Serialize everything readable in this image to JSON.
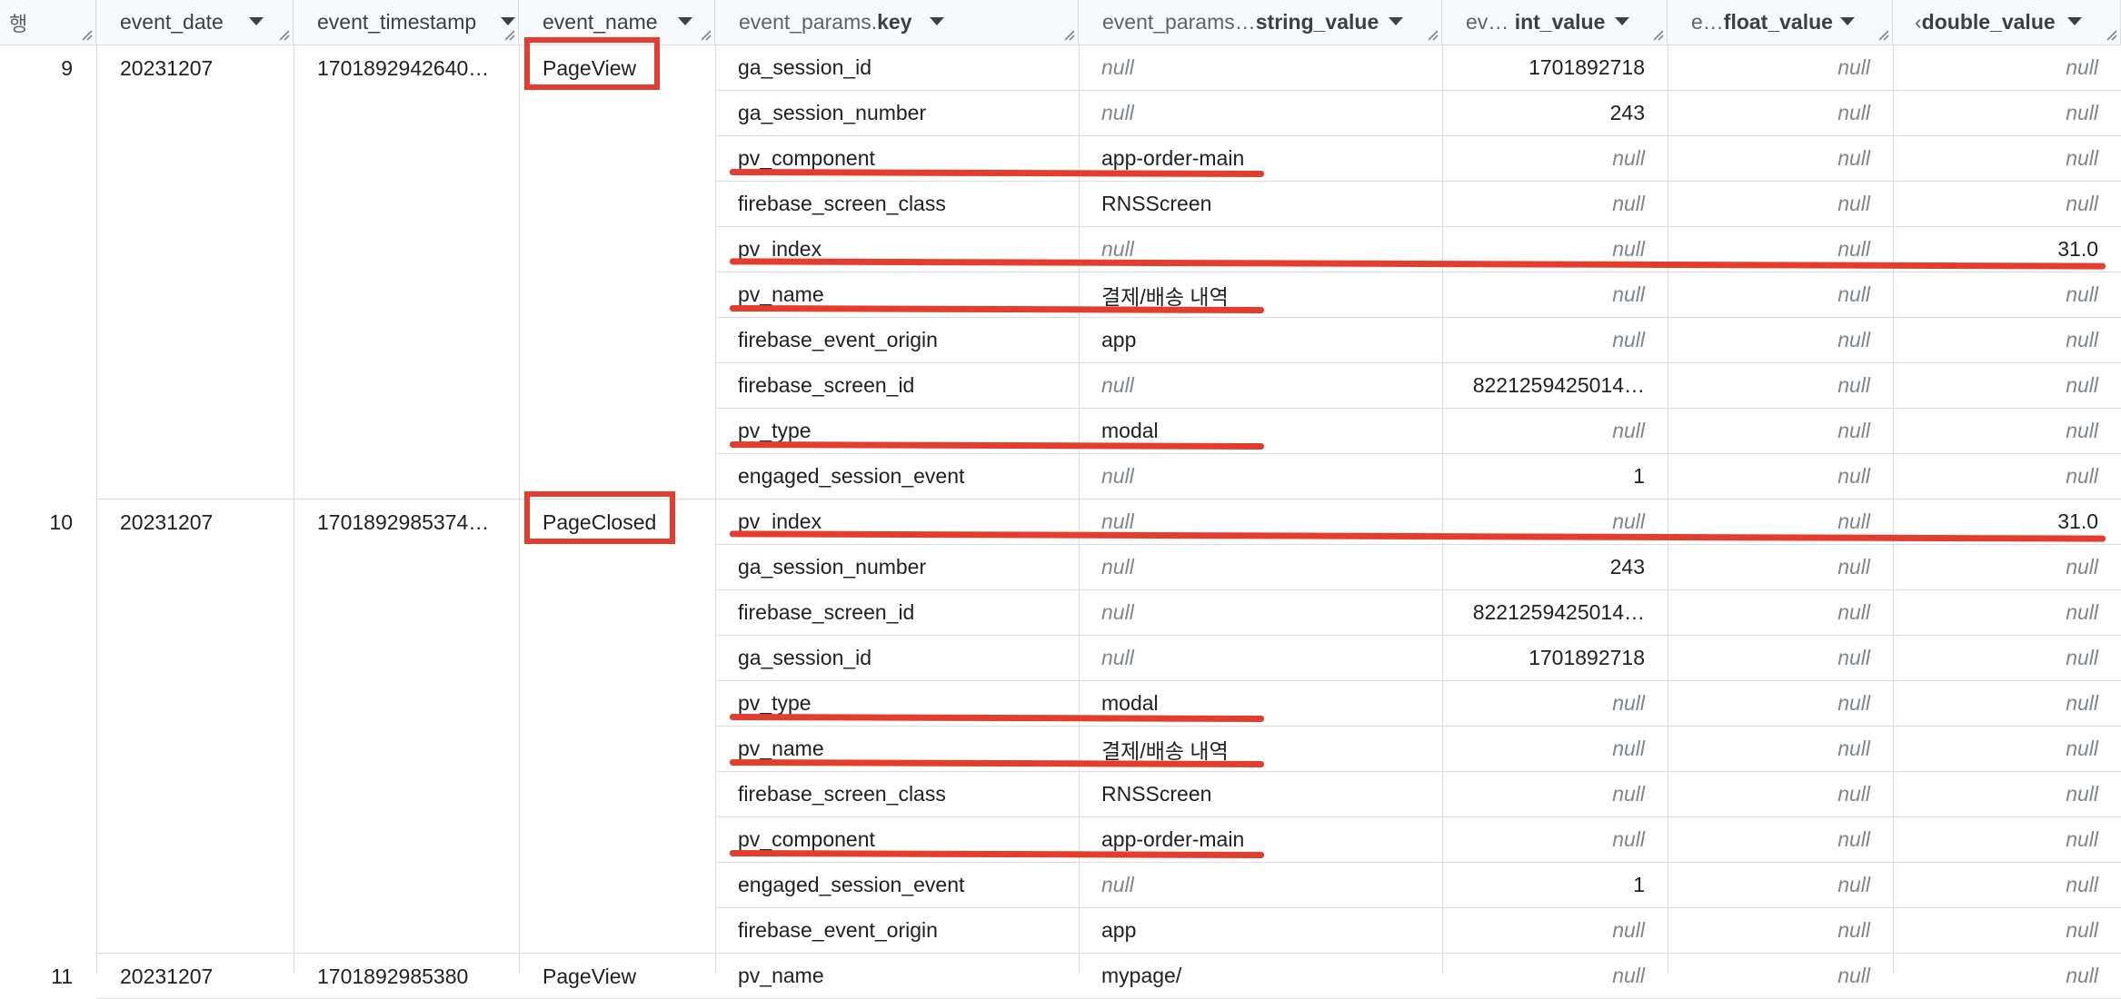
{
  "headers": {
    "row": "행",
    "event_date": "event_date",
    "event_timestamp": "event_timestamp",
    "event_name": "event_name",
    "key_prefix": "event_params.",
    "key_bold": "key",
    "string_prefix": "event_params…",
    "string_bold": "string_value",
    "int_prefix": "ev…",
    "int_bold": "int_value",
    "float_prefix": "e…",
    "float_bold": "float_value",
    "double_prefix": "‹",
    "double_bold": "double_value"
  },
  "rows": [
    {
      "row_number": "9",
      "event_date": "20231207",
      "event_timestamp": "1701892942640…",
      "event_name": "PageView",
      "params": [
        {
          "key": "ga_session_id",
          "string_value": "null",
          "int_value": "1701892718",
          "float_value": "null",
          "double_value": "null"
        },
        {
          "key": "ga_session_number",
          "string_value": "null",
          "int_value": "243",
          "float_value": "null",
          "double_value": "null"
        },
        {
          "key": "pv_component",
          "string_value": "app-order-main",
          "int_value": "null",
          "float_value": "null",
          "double_value": "null"
        },
        {
          "key": "firebase_screen_class",
          "string_value": "RNSScreen",
          "int_value": "null",
          "float_value": "null",
          "double_value": "null"
        },
        {
          "key": "pv_index",
          "string_value": "null",
          "int_value": "null",
          "float_value": "null",
          "double_value": "31.0"
        },
        {
          "key": "pv_name",
          "string_value": "결제/배송 내역",
          "int_value": "null",
          "float_value": "null",
          "double_value": "null"
        },
        {
          "key": "firebase_event_origin",
          "string_value": "app",
          "int_value": "null",
          "float_value": "null",
          "double_value": "null"
        },
        {
          "key": "firebase_screen_id",
          "string_value": "null",
          "int_value": "8221259425014…",
          "float_value": "null",
          "double_value": "null"
        },
        {
          "key": "pv_type",
          "string_value": "modal",
          "int_value": "null",
          "float_value": "null",
          "double_value": "null"
        },
        {
          "key": "engaged_session_event",
          "string_value": "null",
          "int_value": "1",
          "float_value": "null",
          "double_value": "null"
        }
      ]
    },
    {
      "row_number": "10",
      "event_date": "20231207",
      "event_timestamp": "1701892985374…",
      "event_name": "PageClosed",
      "params": [
        {
          "key": "pv_index",
          "string_value": "null",
          "int_value": "null",
          "float_value": "null",
          "double_value": "31.0"
        },
        {
          "key": "ga_session_number",
          "string_value": "null",
          "int_value": "243",
          "float_value": "null",
          "double_value": "null"
        },
        {
          "key": "firebase_screen_id",
          "string_value": "null",
          "int_value": "8221259425014…",
          "float_value": "null",
          "double_value": "null"
        },
        {
          "key": "ga_session_id",
          "string_value": "null",
          "int_value": "1701892718",
          "float_value": "null",
          "double_value": "null"
        },
        {
          "key": "pv_type",
          "string_value": "modal",
          "int_value": "null",
          "float_value": "null",
          "double_value": "null"
        },
        {
          "key": "pv_name",
          "string_value": "결제/배송 내역",
          "int_value": "null",
          "float_value": "null",
          "double_value": "null"
        },
        {
          "key": "firebase_screen_class",
          "string_value": "RNSScreen",
          "int_value": "null",
          "float_value": "null",
          "double_value": "null"
        },
        {
          "key": "pv_component",
          "string_value": "app-order-main",
          "int_value": "null",
          "float_value": "null",
          "double_value": "null"
        },
        {
          "key": "engaged_session_event",
          "string_value": "null",
          "int_value": "1",
          "float_value": "null",
          "double_value": "null"
        },
        {
          "key": "firebase_event_origin",
          "string_value": "app",
          "int_value": "null",
          "float_value": "null",
          "double_value": "null"
        }
      ]
    },
    {
      "row_number": "11",
      "event_date": "20231207",
      "event_timestamp": "1701892985380",
      "event_name": "PageView",
      "params": [
        {
          "key": "pv_name",
          "string_value": "mypage/",
          "int_value": "null",
          "float_value": "null",
          "double_value": "null"
        }
      ]
    }
  ],
  "annotations": {
    "color": "#e53d2d",
    "boxed_event_names": [
      "PageView",
      "PageClosed"
    ],
    "underlined_keys": [
      "pv_component",
      "pv_index",
      "pv_name",
      "pv_type"
    ]
  }
}
